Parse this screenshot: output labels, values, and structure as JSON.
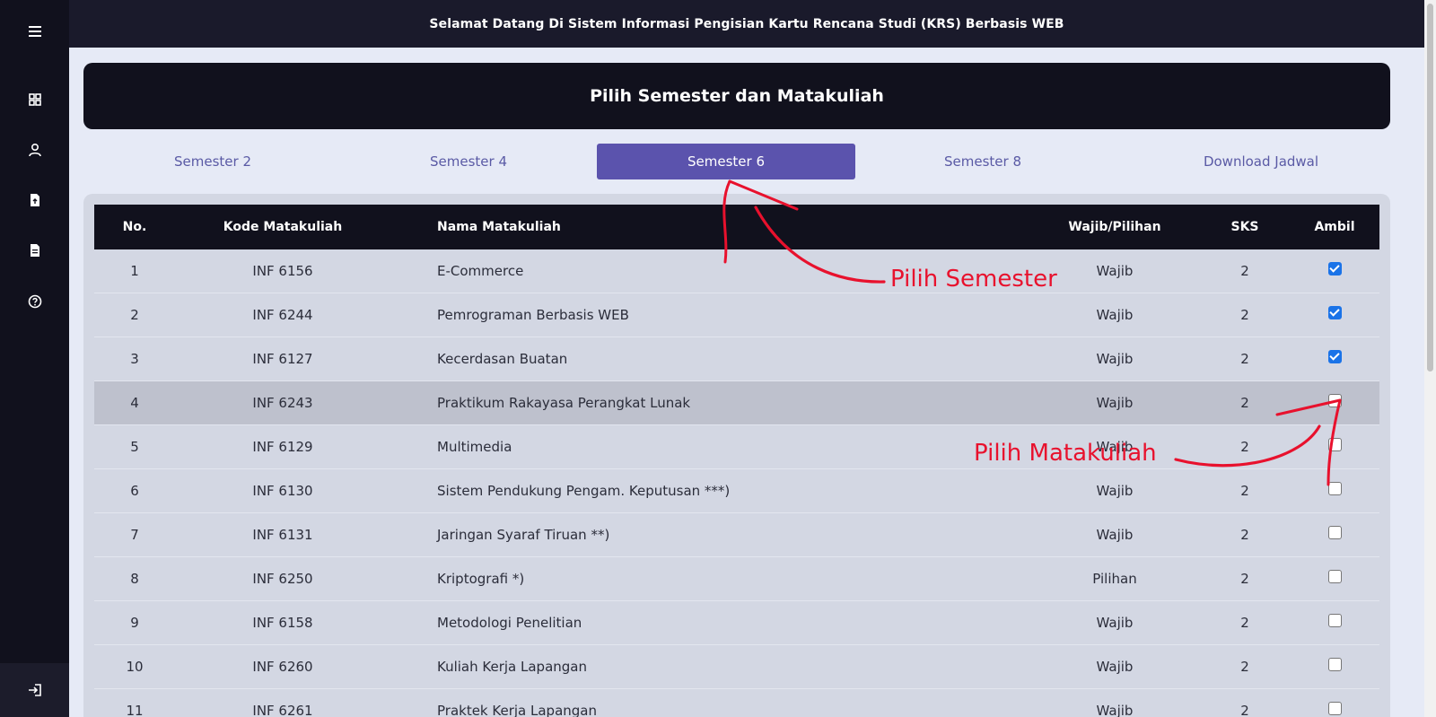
{
  "topbar": {
    "title": "Selamat Datang Di Sistem Informasi Pengisian Kartu Rencana Studi (KRS) Berbasis WEB"
  },
  "header": {
    "title": "Pilih Semester dan Matakuliah"
  },
  "sidebar": {
    "items": [
      {
        "icon": "menu-icon"
      },
      {
        "icon": "dashboard-icon"
      },
      {
        "icon": "user-icon"
      },
      {
        "icon": "file-upload-icon"
      },
      {
        "icon": "document-icon"
      },
      {
        "icon": "help-icon"
      }
    ],
    "logout_icon": "logout-icon"
  },
  "tabs": [
    {
      "label": "Semester 2",
      "active": false
    },
    {
      "label": "Semester 4",
      "active": false
    },
    {
      "label": "Semester 6",
      "active": true
    },
    {
      "label": "Semester 8",
      "active": false
    },
    {
      "label": "Download Jadwal",
      "active": false
    }
  ],
  "table": {
    "headers": {
      "no": "No.",
      "kode": "Kode Matakuliah",
      "nama": "Nama Matakuliah",
      "wajib": "Wajib/Pilihan",
      "sks": "SKS",
      "ambil": "Ambil"
    },
    "rows": [
      {
        "no": "1",
        "kode": "INF 6156",
        "nama": "E-Commerce",
        "wajib": "Wajib",
        "sks": "2",
        "checked": true
      },
      {
        "no": "2",
        "kode": "INF 6244",
        "nama": "Pemrograman Berbasis WEB",
        "wajib": "Wajib",
        "sks": "2",
        "checked": true
      },
      {
        "no": "3",
        "kode": "INF 6127",
        "nama": "Kecerdasan Buatan",
        "wajib": "Wajib",
        "sks": "2",
        "checked": true
      },
      {
        "no": "4",
        "kode": "INF 6243",
        "nama": "Praktikum Rakayasa Perangkat Lunak",
        "wajib": "Wajib",
        "sks": "2",
        "checked": false
      },
      {
        "no": "5",
        "kode": "INF 6129",
        "nama": "Multimedia",
        "wajib": "Wajib",
        "sks": "2",
        "checked": false
      },
      {
        "no": "6",
        "kode": "INF 6130",
        "nama": "Sistem Pendukung Pengam. Keputusan ***)",
        "wajib": "Wajib",
        "sks": "2",
        "checked": false
      },
      {
        "no": "7",
        "kode": "INF 6131",
        "nama": "Jaringan Syaraf Tiruan **)",
        "wajib": "Wajib",
        "sks": "2",
        "checked": false
      },
      {
        "no": "8",
        "kode": "INF 6250",
        "nama": "Kriptografi *)",
        "wajib": "Pilihan",
        "sks": "2",
        "checked": false
      },
      {
        "no": "9",
        "kode": "INF 6158",
        "nama": "Metodologi Penelitian",
        "wajib": "Wajib",
        "sks": "2",
        "checked": false
      },
      {
        "no": "10",
        "kode": "INF 6260",
        "nama": "Kuliah Kerja Lapangan",
        "wajib": "Wajib",
        "sks": "2",
        "checked": false
      },
      {
        "no": "11",
        "kode": "INF 6261",
        "nama": "Praktek Kerja Lapangan",
        "wajib": "Wajib",
        "sks": "2",
        "checked": false
      }
    ]
  },
  "annotations": {
    "pilih_semester": "Pilih Semester",
    "pilih_matakuliah": "Pilih Matakuliah"
  },
  "colors": {
    "sidebar": "#11111d",
    "topbar": "#1a1a2b",
    "accent": "#5b53ad",
    "annotation": "#e8112d",
    "checkbox_checked": "#1a73e8"
  }
}
